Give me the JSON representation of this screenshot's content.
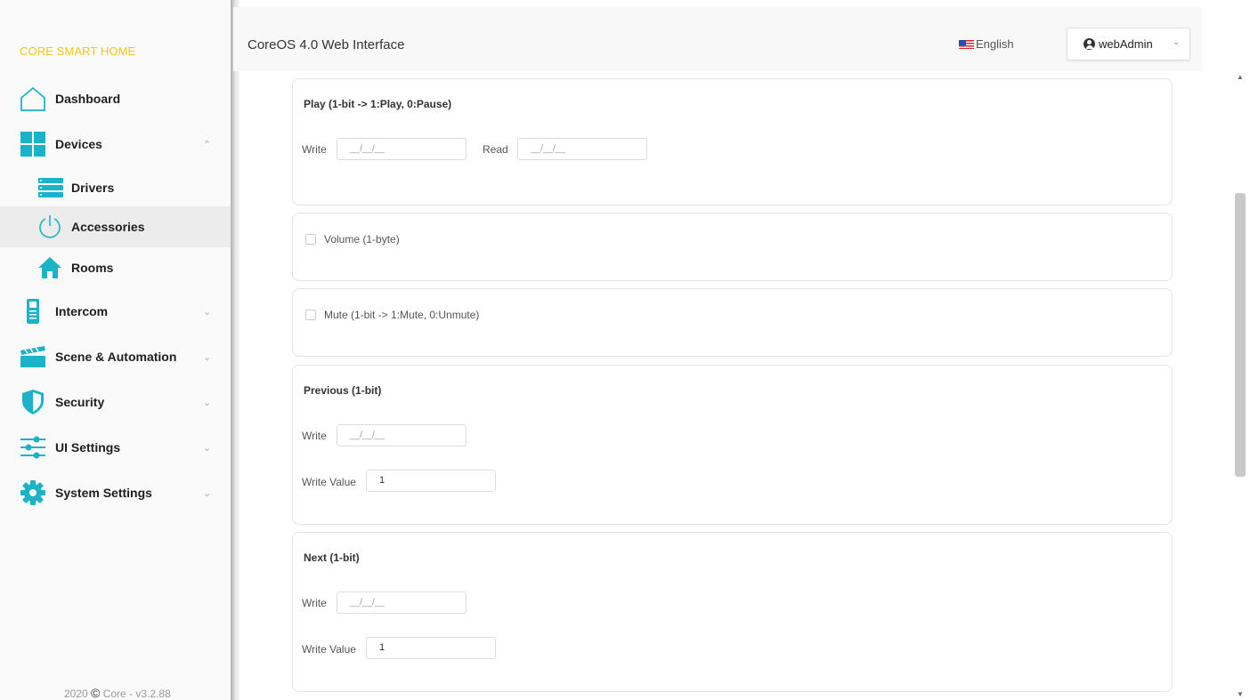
{
  "brand": "CORE SMART HOME",
  "app_title": "CoreOS 4.0 Web Interface",
  "language": "English",
  "user": {
    "name": "webAdmin"
  },
  "sidebar": {
    "items": [
      {
        "label": "Dashboard",
        "icon": "house-icon"
      },
      {
        "label": "Devices",
        "icon": "devices-grid-icon",
        "chevron": "^"
      },
      {
        "label": "Drivers",
        "icon": "drivers-list-icon"
      },
      {
        "label": "Accessories",
        "icon": "power-icon"
      },
      {
        "label": "Rooms",
        "icon": "room-house-icon"
      },
      {
        "label": "Intercom",
        "icon": "intercom-icon",
        "chevron": "v"
      },
      {
        "label": "Scene & Automation",
        "icon": "clapperboard-icon",
        "chevron": "v"
      },
      {
        "label": "Security",
        "icon": "shield-icon",
        "chevron": "v"
      },
      {
        "label": "UI Settings",
        "icon": "sliders-icon",
        "chevron": "v"
      },
      {
        "label": "System Settings",
        "icon": "gear-icon",
        "chevron": "v"
      }
    ],
    "footer_year": "2020",
    "footer_text": "Core - v3.2.88"
  },
  "cards": {
    "play": {
      "title": "Play (1-bit -> 1:Play, 0:Pause)",
      "write_label": "Write",
      "write_placeholder": "__/__/__",
      "read_label": "Read",
      "read_placeholder": "__/__/__"
    },
    "volume": {
      "label": "Volume (1-byte)"
    },
    "mute": {
      "label": "Mute (1-bit -> 1:Mute, 0:Unmute)"
    },
    "previous": {
      "title": "Previous (1-bit)",
      "write_label": "Write",
      "write_placeholder": "__/__/__",
      "value_label": "Write Value",
      "value": "1"
    },
    "next": {
      "title": "Next (1-bit)",
      "write_label": "Write",
      "write_placeholder": "__/__/__",
      "value_label": "Write Value",
      "value": "1"
    }
  },
  "colors": {
    "accent": "#1bb3c8",
    "brand": "#f5c518"
  }
}
